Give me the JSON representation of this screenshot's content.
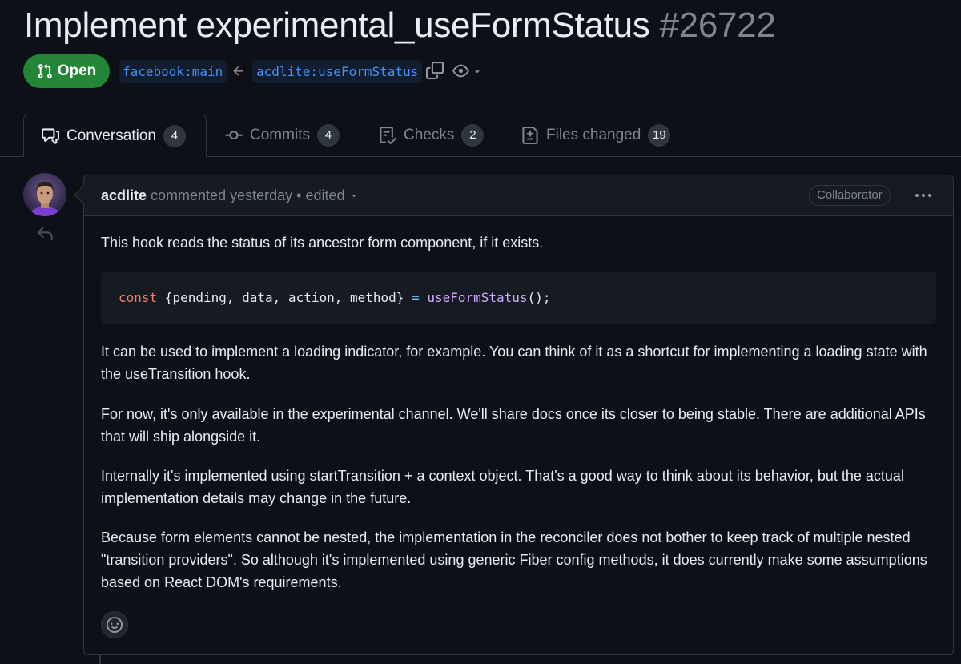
{
  "pr": {
    "title": "Implement experimental_useFormStatus",
    "number": "#26722",
    "state": "Open",
    "base_branch": "facebook:main",
    "head_branch": "acdlite:useFormStatus"
  },
  "tabs": [
    {
      "label": "Conversation",
      "count": "4",
      "icon": "comment-discussion-icon"
    },
    {
      "label": "Commits",
      "count": "4",
      "icon": "commit-icon"
    },
    {
      "label": "Checks",
      "count": "2",
      "icon": "checklist-icon"
    },
    {
      "label": "Files changed",
      "count": "19",
      "icon": "file-diff-icon"
    }
  ],
  "comment": {
    "author": "acdlite",
    "action": "commented yesterday",
    "separator": "•",
    "edited": "edited",
    "role": "Collaborator",
    "paragraphs": [
      "This hook reads the status of its ancestor form component, if it exists.",
      "It can be used to implement a loading indicator, for example. You can think of it as a shortcut for implementing a loading state with the useTransition hook.",
      "For now, it's only available in the experimental channel. We'll share docs once its closer to being stable. There are additional APIs that will ship alongside it.",
      "Internally it's implemented using startTransition + a context object. That's a good way to think about its behavior, but the actual implementation details may change in the future.",
      "Because form elements cannot be nested, the implementation in the reconciler does not bother to keep track of multiple nested \"transition providers\". So although it's implemented using generic Fiber config methods, it does currently make some assumptions based on React DOM's requirements."
    ],
    "code": {
      "keyword": "const",
      "destructure": " {pending, data, action, method} ",
      "operator": "=",
      "function": "useFormStatus",
      "tail": "();"
    }
  },
  "colors": {
    "background": "#0d1117",
    "open_green": "#238636",
    "branch_blue": "#4493f8",
    "muted_text": "#7d8590",
    "border": "#30363d"
  }
}
